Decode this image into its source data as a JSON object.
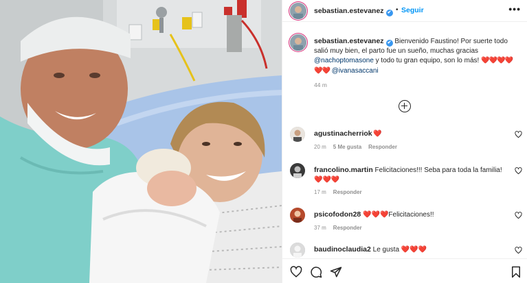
{
  "post": {
    "author": {
      "username": "sebastian.estevanez",
      "avatar_icon": "profile-photo",
      "verified": true,
      "verified_glyph": "✔"
    },
    "header": {
      "separator": "•",
      "follow_label": "Seguir",
      "more_glyph": "•••"
    },
    "caption": {
      "text_before": " Bienvenido Faustino! Por suerte todo salió muy bien, el parto fue un sueño, muchas gracias ",
      "mention_1": "@nachoptomasone",
      "text_middle": " y todo tu gran equipo, son lo más! ",
      "hearts": "❤️❤️❤️❤️❤️❤️",
      "mention_2": "@ivanasaccani",
      "time": "44 m"
    },
    "load_more_icon": "plus-circle-icon"
  },
  "comments": [
    {
      "username": "agustinacherriok",
      "text": " ❤️",
      "time": "20 m",
      "likes": "5 Me gusta",
      "reply_label": "Responder"
    },
    {
      "username": "francolino.martin",
      "text": " Felicitaciones!!! Seba para toda la familia! ❤️❤️❤️",
      "time": "17 m",
      "likes": "",
      "reply_label": "Responder"
    },
    {
      "username": "psicofodon28",
      "text": " ❤️❤️❤️Felicitaciones!!",
      "time": "37 m",
      "likes": "",
      "reply_label": "Responder"
    },
    {
      "username": "baudinoclaudia2",
      "text": " Le gusta ❤️❤️❤️",
      "time": "",
      "likes": "",
      "reply_label": ""
    }
  ],
  "actions": {
    "icons": [
      "heart-icon",
      "comment-icon",
      "share-icon",
      "bookmark-icon"
    ]
  },
  "colors": {
    "link": "#0095f6",
    "mention": "#00376b",
    "heart": "#ed4956",
    "secondary_text": "#8e8e8e",
    "verified": "#3897f0"
  }
}
